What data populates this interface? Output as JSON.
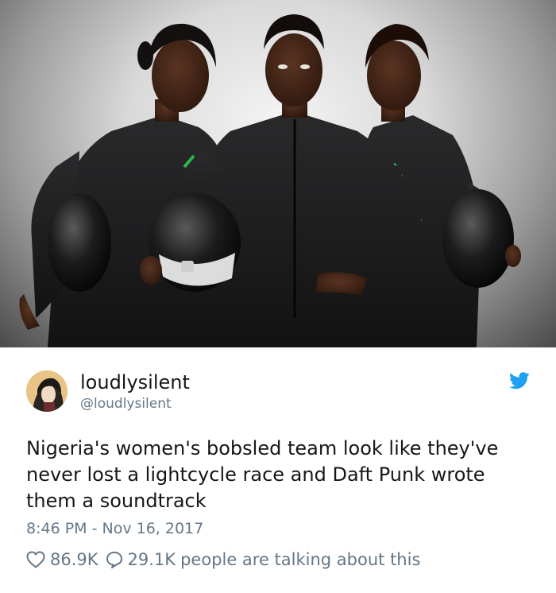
{
  "tweet": {
    "display_name": "loudlysilent",
    "handle": "@loudlysilent",
    "text": "Nigeria's women's bobsled team look like they've\nnever lost a lightcycle race and Daft Punk wrote\nthem a soundtrack",
    "timestamp": "8:46 PM - Nov 16, 2017",
    "likes": "86.9K",
    "replies": "29.1K",
    "talking_label": "people are talking about this"
  },
  "icons": {
    "brand": "twitter-bird-icon",
    "like": "heart-icon",
    "reply": "speech-bubble-icon"
  },
  "colors": {
    "twitter_blue": "#1da1f2",
    "secondary_text": "#657786",
    "primary_text": "#14171a",
    "suit_accent": "#2bb64a"
  }
}
